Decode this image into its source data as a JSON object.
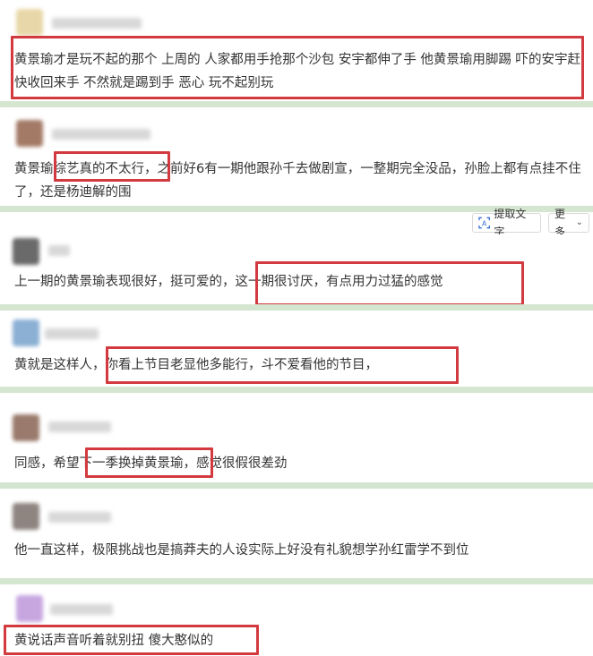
{
  "toolbar": {
    "extract_text_label": "提取文字",
    "more_label": "更多"
  },
  "comments": [
    {
      "text": "黄景瑜才是玩不起的那个 上周的 人家都用手抢那个沙包 安宇都伸了手 他黄景瑜用脚踢 吓的安宇赶快收回来手 不然就是踢到手 恶心 玩不起别玩"
    },
    {
      "text": "黄景瑜综艺真的不太行，之前好6有一期他跟孙千去做剧宣，一整期完全没品，孙脸上都有点挂不住了，还是杨迪解的围"
    },
    {
      "text": "上一期的黄景瑜表现很好，挺可爱的，这一期很讨厌，有点用力过猛的感觉"
    },
    {
      "text": "黄就是这样人，你看上节目老显他多能行，斗不爱看他的节目，"
    },
    {
      "text": "同感，希望下一季换掉黄景瑜，感觉很假很差劲"
    },
    {
      "text": "他一直这样，极限挑战也是搞莽夫的人设实际上好没有礼貌想学孙红雷学不到位"
    },
    {
      "text": "黄说话声音听着就别扭 傻大憨似的"
    }
  ],
  "colors": {
    "highlight": "#d23a3f",
    "separator": "#d4e6d0",
    "text": "#333333"
  }
}
